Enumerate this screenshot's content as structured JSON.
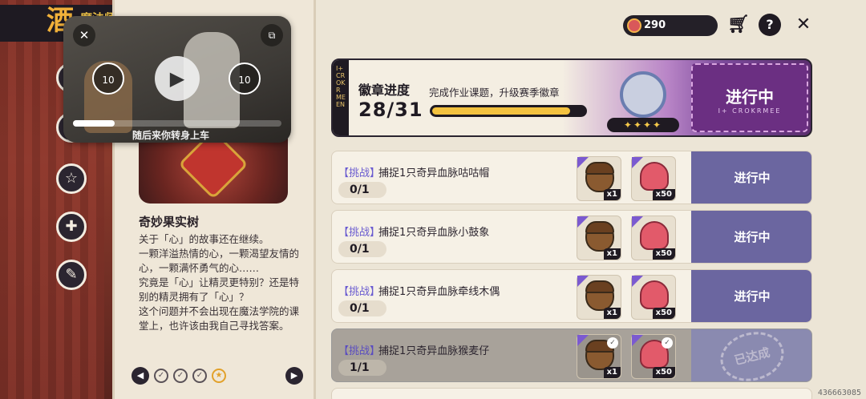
{
  "header": {
    "title": "魔法师手册",
    "logo": "酒",
    "currency_value": "290",
    "icons": [
      "cart-icon",
      "help-icon",
      "close-icon"
    ]
  },
  "sidebar": {
    "icons": [
      "swords-icon",
      "paw-icon",
      "star-badge-icon",
      "bone-icon",
      "quiz-badge-icon"
    ]
  },
  "video": {
    "rewind_label": "10",
    "forward_label": "10",
    "progress": 0.2,
    "caption": "随后来你转身上车"
  },
  "card": {
    "title": "奇妙果实树",
    "description": "关于「心」的故事还在继续。\n一颗洋溢热情的心，一颗渴望友情的心，一颗满怀勇气的心……\n究竟是「心」让精灵更特别？还是特别的精灵拥有了「心」？\n这个问题并不会出现在魔法学院的课堂上，也许该由我自己寻找答案。",
    "pager_dots": [
      "✓",
      "✓",
      "✓",
      "★"
    ]
  },
  "banner": {
    "side_text": "I+ CROKRMEEN",
    "title": "徽章进度",
    "subtitle": "完成作业课题，升级赛季徽章",
    "count": "28/31",
    "progress": 0.903,
    "stars": "✦✦✦✦",
    "status": "进行中",
    "status_sub": "I+ CROKRMEE"
  },
  "tasks": [
    {
      "tag": "【挑战】",
      "name": "捕捉1只奇异血脉咕咕帽",
      "progress": "0/1",
      "rewards": [
        {
          "type": "acorn",
          "qty": "x1"
        },
        {
          "type": "shell",
          "qty": "x50"
        }
      ],
      "status": "进行中",
      "done": false
    },
    {
      "tag": "【挑战】",
      "name": "捕捉1只奇异血脉小鼓象",
      "progress": "0/1",
      "rewards": [
        {
          "type": "acorn",
          "qty": "x1"
        },
        {
          "type": "shell",
          "qty": "x50"
        }
      ],
      "status": "进行中",
      "done": false
    },
    {
      "tag": "【挑战】",
      "name": "捕捉1只奇异血脉牵线木偶",
      "progress": "0/1",
      "rewards": [
        {
          "type": "acorn",
          "qty": "x1"
        },
        {
          "type": "shell",
          "qty": "x50"
        }
      ],
      "status": "进行中",
      "done": false
    },
    {
      "tag": "【挑战】",
      "name": "捕捉1只奇异血脉猴麦仔",
      "progress": "1/1",
      "rewards": [
        {
          "type": "acorn",
          "qty": "x1"
        },
        {
          "type": "shell",
          "qty": "x50"
        }
      ],
      "status": "已达成",
      "done": true
    }
  ],
  "footer_id": "436663085"
}
